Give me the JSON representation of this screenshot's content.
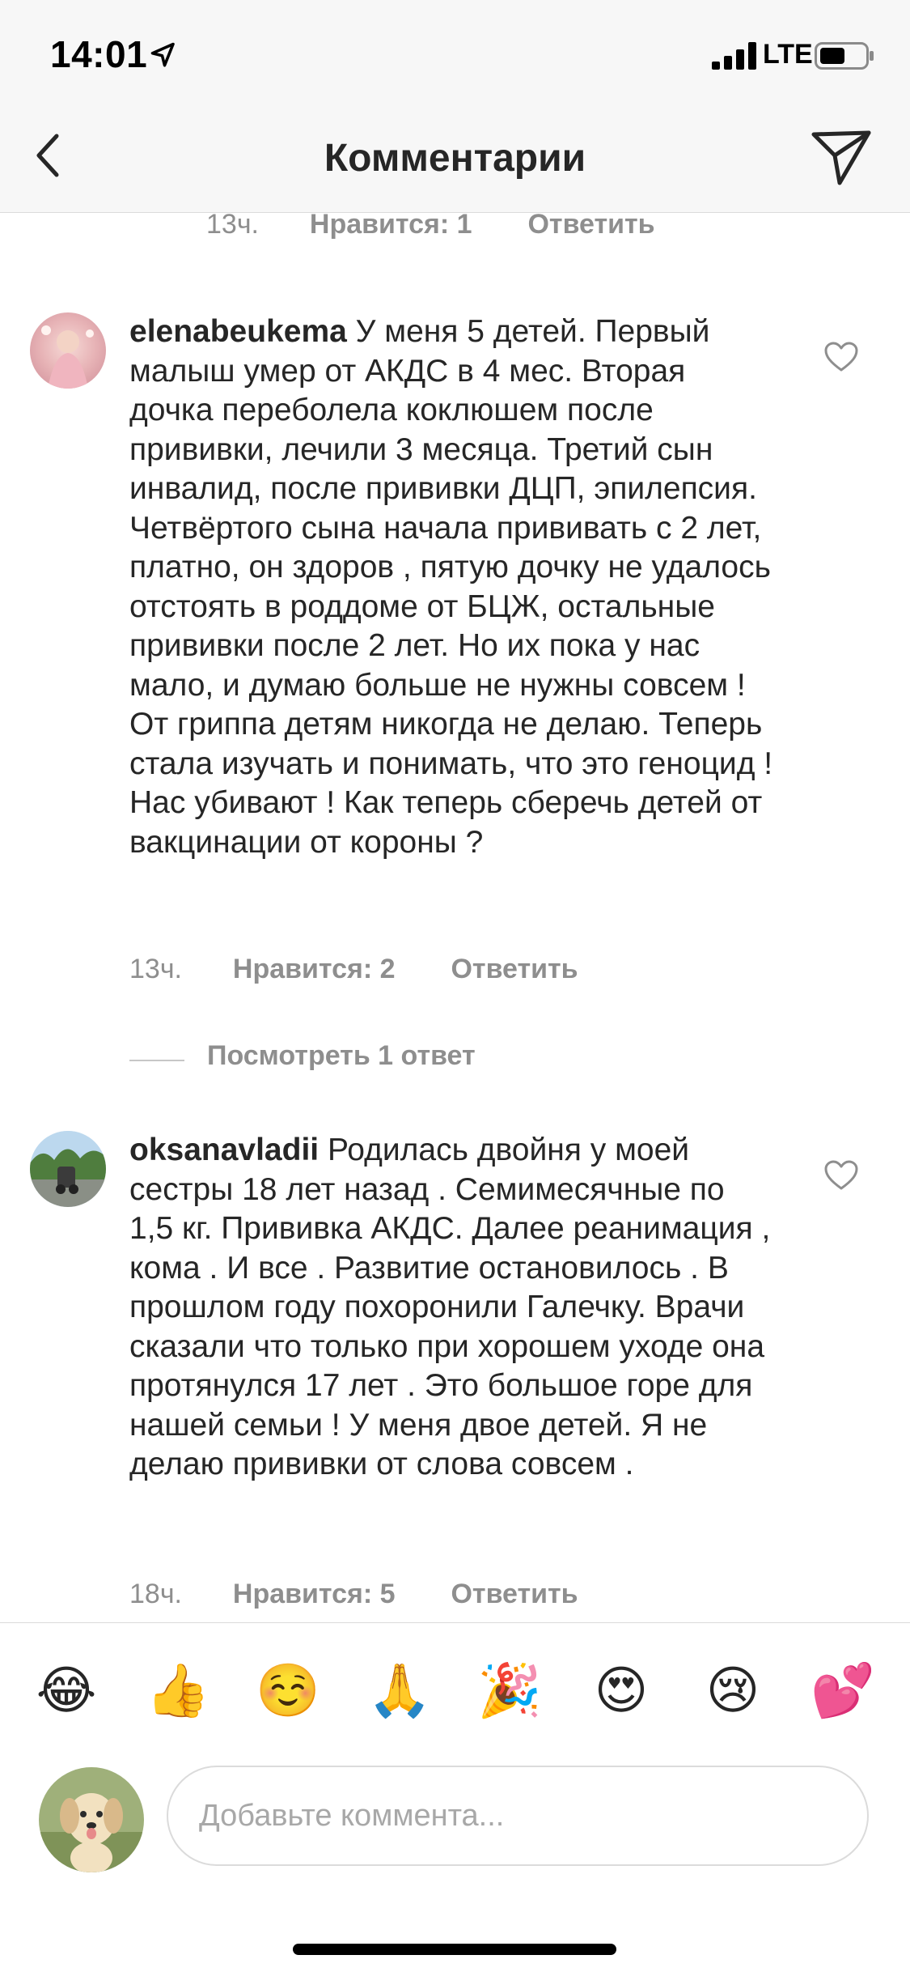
{
  "status_bar": {
    "time": "14:01",
    "network": "LTE"
  },
  "header": {
    "title": "Комментарии",
    "back_icon": "chevron-left-icon",
    "send_icon": "paper-plane-icon"
  },
  "previous_comment_meta": {
    "time": "13ч.",
    "likes": "Нравится: 1",
    "reply": "Ответить"
  },
  "comments": [
    {
      "username": "elenabeukema",
      "text": "У меня 5 детей. Первый малыш умер от АКДС в 4 мес. Вторая дочка  переболела  коклюшем после прививки, лечили 3 месяца. Третий сын инвалид, после прививки ДЦП, эпилепсия. Четвёртого сына начала прививать с 2 лет, платно, он здоров , пятую дочку не удалось отстоять в роддоме от БЦЖ, остальные прививки после 2 лет. Но их пока у нас мало, и думаю больше не нужны совсем ! От гриппа детям никогда не делаю. Теперь стала изучать и понимать, что это геноцид ! Нас убивают ! Как теперь сберечь детей от вакцинации от короны ?",
      "time": "13ч.",
      "likes": "Нравится: 2",
      "reply": "Ответить",
      "view_replies": "Посмотреть 1 ответ"
    },
    {
      "username": "oksanavladii",
      "text": "Родилась двойня у моей сестры 18 лет назад . Семимесячные по 1,5 кг. Прививка АКДС. Далее реанимация , кома . И все . Развитие остановилось . В прошлом году похоронили Галечку. Врачи сказали что только при хорошем уходе она протянулся 17 лет . Это большое горе для нашей семьи !  У меня двое детей. Я не делаю прививки от слова совсем .",
      "time": "18ч.",
      "likes": "Нравится: 5",
      "reply": "Ответить"
    }
  ],
  "emoji_bar": [
    "😂",
    "👍",
    "☺️",
    "🙏",
    "🎉",
    "😍",
    "😢",
    "💕"
  ],
  "composer": {
    "placeholder": "Добавьте коммента..."
  },
  "colors": {
    "text_primary": "#262626",
    "text_secondary": "#8e8e8e",
    "header_bg": "#f7f7f7",
    "divider": "#dbdbdb"
  }
}
